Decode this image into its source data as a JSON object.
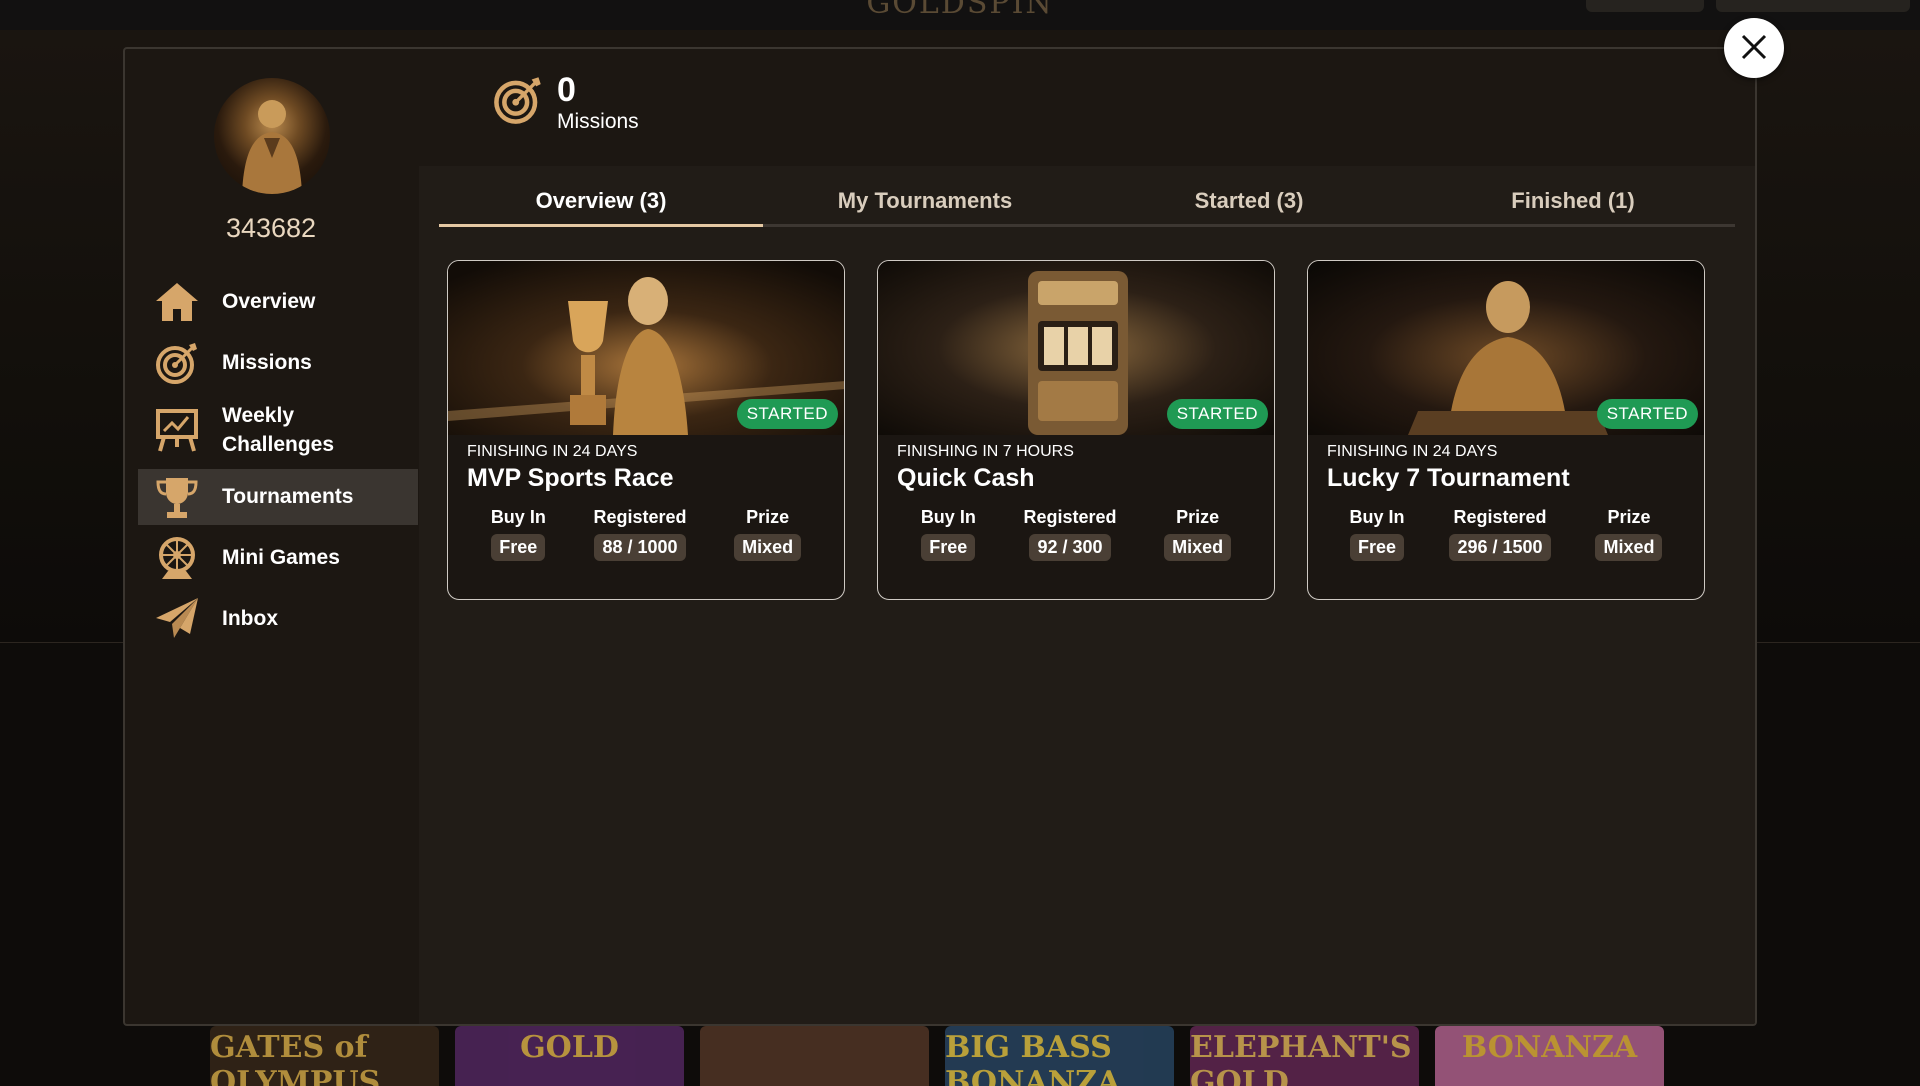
{
  "background": {
    "brand": "GOLDSPIN",
    "games": [
      {
        "title": "GATES of OLYMPUS",
        "bg": "#3a2a1a",
        "fg": "#e7b84d"
      },
      {
        "title": "GOLD",
        "bg": "#5a2a6a",
        "fg": "#f0c050"
      },
      {
        "title": "",
        "bg": "#5a3a2a",
        "fg": "#e0b070"
      },
      {
        "title": "BIG BASS BONANZA",
        "bg": "#2a4a6a",
        "fg": "#f2d24a"
      },
      {
        "title": "ELEPHANT'S GOLD",
        "bg": "#6a2a5a",
        "fg": "#f0c060"
      },
      {
        "title": "BONANZA",
        "bg": "#c06a9a",
        "fg": "#f4c040"
      }
    ]
  },
  "modal": {
    "close_icon": "close-icon",
    "user_id": "343682",
    "missions": {
      "count": "0",
      "label": "Missions",
      "icon": "target-icon"
    },
    "nav": [
      {
        "label": "Overview",
        "icon": "home-icon",
        "active": false
      },
      {
        "label": "Missions",
        "icon": "target-icon",
        "active": false
      },
      {
        "label": "Weekly Challenges",
        "icon": "easel-icon",
        "active": false
      },
      {
        "label": "Tournaments",
        "icon": "trophy-icon",
        "active": true
      },
      {
        "label": "Mini Games",
        "icon": "wheel-icon",
        "active": false
      },
      {
        "label": "Inbox",
        "icon": "paper-plane-icon",
        "active": false
      }
    ],
    "tabs": [
      {
        "label": "Overview (3)",
        "active": true
      },
      {
        "label": "My Tournaments",
        "active": false
      },
      {
        "label": "Started (3)",
        "active": false
      },
      {
        "label": "Finished (1)",
        "active": false
      }
    ],
    "cards": [
      {
        "status": "STARTED",
        "finishing": "FINISHING IN 24 DAYS",
        "title": "MVP Sports Race",
        "buy_in_label": "Buy In",
        "buy_in": "Free",
        "registered_label": "Registered",
        "registered": "88 / 1000",
        "prize_label": "Prize",
        "prize": "Mixed"
      },
      {
        "status": "STARTED",
        "finishing": "FINISHING IN 7 HOURS",
        "title": "Quick Cash",
        "buy_in_label": "Buy In",
        "buy_in": "Free",
        "registered_label": "Registered",
        "registered": "92 / 300",
        "prize_label": "Prize",
        "prize": "Mixed"
      },
      {
        "status": "STARTED",
        "finishing": "FINISHING IN 24 DAYS",
        "title": "Lucky 7 Tournament",
        "buy_in_label": "Buy In",
        "buy_in": "Free",
        "registered_label": "Registered",
        "registered": "296 / 1500",
        "prize_label": "Prize",
        "prize": "Mixed"
      }
    ],
    "colors": {
      "accent": "#e5c8a3",
      "badge": "#1f9a54",
      "panel": "#1c1712",
      "content": "#211c17"
    }
  }
}
